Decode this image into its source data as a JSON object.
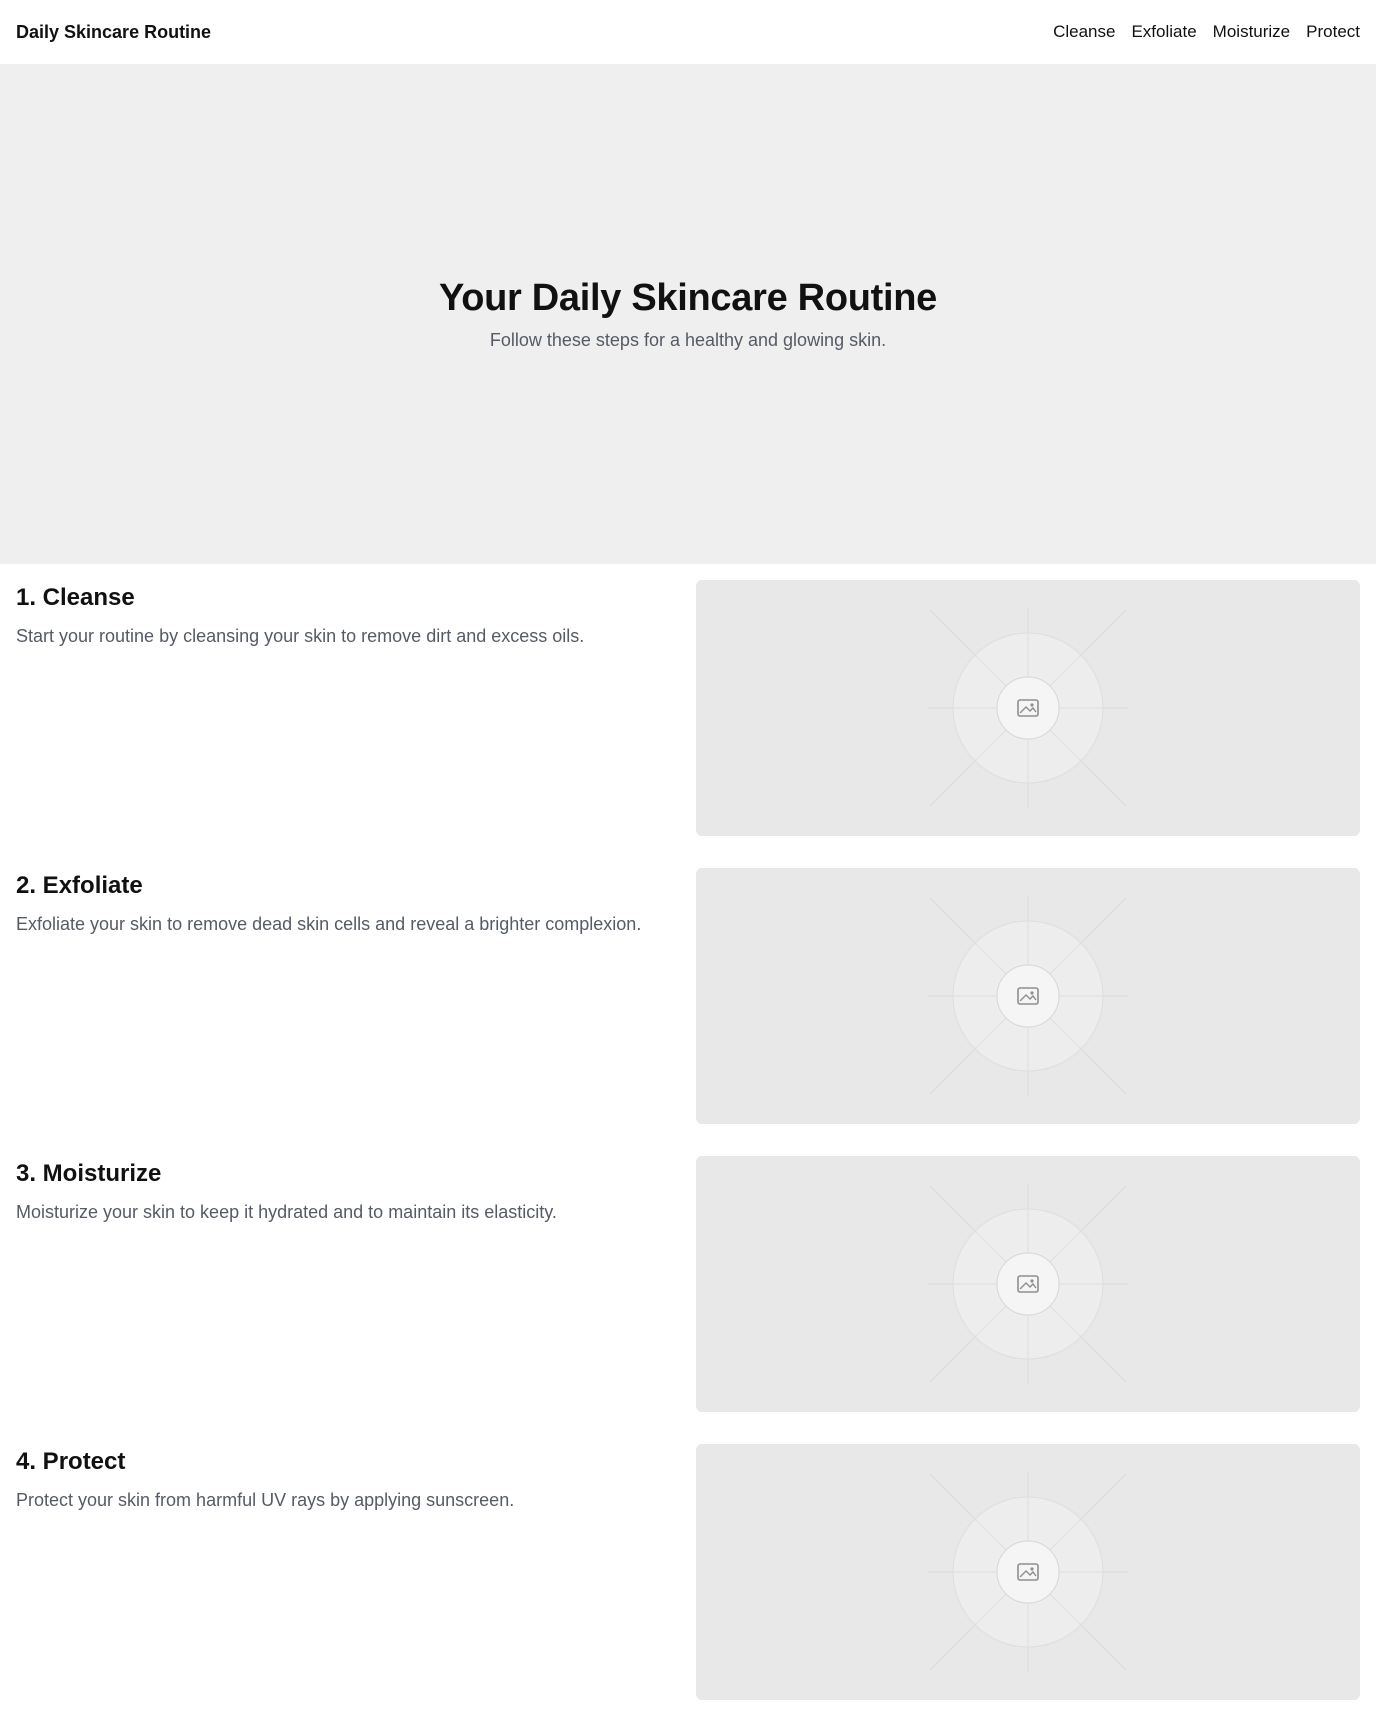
{
  "header": {
    "brand": "Daily Skincare Routine",
    "nav": [
      "Cleanse",
      "Exfoliate",
      "Moisturize",
      "Protect"
    ]
  },
  "hero": {
    "title": "Your Daily Skincare Routine",
    "subtitle": "Follow these steps for a healthy and glowing skin."
  },
  "steps": [
    {
      "title": "1. Cleanse",
      "description": "Start your routine by cleansing your skin to remove dirt and excess oils.",
      "image_icon": "image-placeholder-icon"
    },
    {
      "title": "2. Exfoliate",
      "description": "Exfoliate your skin to remove dead skin cells and reveal a brighter complexion.",
      "image_icon": "image-placeholder-icon"
    },
    {
      "title": "3. Moisturize",
      "description": "Moisturize your skin to keep it hydrated and to maintain its elasticity.",
      "image_icon": "image-placeholder-icon"
    },
    {
      "title": "4. Protect",
      "description": "Protect your skin from harmful UV rays by applying sunscreen.",
      "image_icon": "image-placeholder-icon"
    }
  ]
}
